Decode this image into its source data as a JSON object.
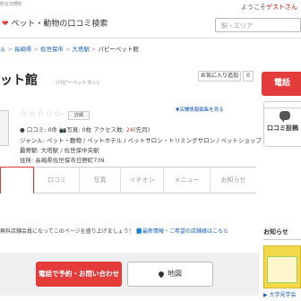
{
  "header": {
    "toptext": "所在日野町",
    "welcome_prefix": "ようこそ",
    "welcome_guest": "ゲストさん",
    "logo_text": "ペット・動物の口コミ検索",
    "search_placeholder": "駅・エリア"
  },
  "breadcrumb": [
    {
      "label": "ル",
      "link": true
    },
    {
      "label": "長崎県",
      "link": true
    },
    {
      "label": "佐世保市",
      "link": true
    },
    {
      "label": "大塔駅",
      "link": true
    },
    {
      "label": "パピーペット館",
      "link": false
    }
  ],
  "title": {
    "name": "ット館",
    "reading": "(パピーペットカン)"
  },
  "favorite": {
    "label": "お気に入り追加",
    "count": "0"
  },
  "cta": {
    "phone_label": "電話",
    "review_label": "口コミ投稿"
  },
  "rating": {
    "stars": "☆☆☆☆☆",
    "value": "-",
    "detail_label": "詳細"
  },
  "edit_link": "▼店舗情報編集を見る",
  "info": {
    "stats": {
      "review_label": "口コミ",
      "review_count": "0件",
      "photo_label": "写真",
      "photo_count": "0枚",
      "access_label": "アクセス数",
      "access_count": "24",
      "access_suffix": "(先月)"
    },
    "genre_label": "ジャンル",
    "genre": "ペット・動物 / ペットホテル / ペットサロン・トリミングサロン / ペットショップ",
    "station_label": "最寄駅",
    "station": "大塔駅 / 佐世保中央駅",
    "address_label": "住所",
    "address": "長崎県佐世保市日野町739"
  },
  "tabs": [
    "口コミ",
    "写真",
    "イチオシ",
    "メニュー",
    "お知らせ"
  ],
  "notice": {
    "text": "無料店舗会員になってこのページを盛り上げましょう！",
    "link": "最新情報・ご希望の店舗様はこちら"
  },
  "sidebar": {
    "oshirase": "お知らせ",
    "ad_link": "▶ 大学見学会"
  },
  "bottom": {
    "contact_label": "電話で予約・お問い合わせ",
    "map_label": "地図"
  },
  "colors": {
    "accent": "#e43b3b",
    "link": "#1a5bb8"
  }
}
